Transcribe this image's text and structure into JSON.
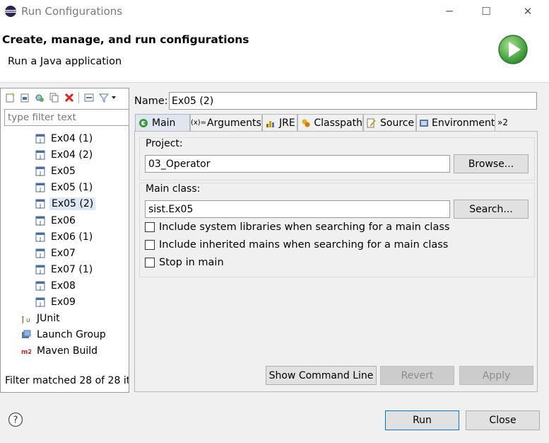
{
  "window": {
    "title": "Run Configurations",
    "minimize_glyph": "─",
    "maximize_glyph": "☐",
    "close_glyph": "✕"
  },
  "header": {
    "title": "Create, manage, and run configurations",
    "subtitle": "Run a Java application"
  },
  "left": {
    "filter_placeholder": "type filter text",
    "items": [
      {
        "label": "Ex04 (1)",
        "icon": "java-app-icon"
      },
      {
        "label": "Ex04 (2)",
        "icon": "java-app-icon"
      },
      {
        "label": "Ex05",
        "icon": "java-app-icon"
      },
      {
        "label": "Ex05 (1)",
        "icon": "java-app-icon"
      },
      {
        "label": "Ex05 (2)",
        "icon": "java-app-icon",
        "selected": true
      },
      {
        "label": "Ex06",
        "icon": "java-app-icon"
      },
      {
        "label": "Ex06 (1)",
        "icon": "java-app-icon"
      },
      {
        "label": "Ex07",
        "icon": "java-app-icon"
      },
      {
        "label": "Ex07 (1)",
        "icon": "java-app-icon"
      },
      {
        "label": "Ex08",
        "icon": "java-app-icon"
      },
      {
        "label": "Ex09",
        "icon": "java-app-icon"
      },
      {
        "label": "JUnit",
        "icon": "junit-icon"
      },
      {
        "label": "Launch Group",
        "icon": "launch-group-icon"
      },
      {
        "label": "Maven Build",
        "icon": "maven-icon"
      }
    ],
    "filter_status": "Filter matched 28 of 28 it"
  },
  "config": {
    "name_label": "Name:",
    "name_value": "Ex05 (2)",
    "tabs": [
      {
        "label": "Main",
        "icon": "main-tab-icon"
      },
      {
        "label": "Arguments",
        "icon": "arguments-icon"
      },
      {
        "label": "JRE",
        "icon": "jre-icon"
      },
      {
        "label": "Classpath",
        "icon": "classpath-icon"
      },
      {
        "label": "Source",
        "icon": "source-icon"
      },
      {
        "label": "Environment",
        "icon": "environment-icon"
      },
      {
        "label": "»2",
        "icon": ""
      }
    ],
    "project_label": "Project:",
    "project_value": "03_Operator",
    "browse_label": "Browse...",
    "main_class_label": "Main class:",
    "main_class_value": "sist.Ex05",
    "search_label": "Search...",
    "checks": [
      "Include system libraries when searching for a main class",
      "Include inherited mains when searching for a main class",
      "Stop in main"
    ],
    "show_command_line": "Show Command Line",
    "revert": "Revert",
    "apply": "Apply"
  },
  "footer": {
    "run": "Run",
    "close": "Close"
  },
  "colors": {
    "accent": "#0078d7",
    "selection": "#dde8f5",
    "run_green": "#3aa53a"
  }
}
